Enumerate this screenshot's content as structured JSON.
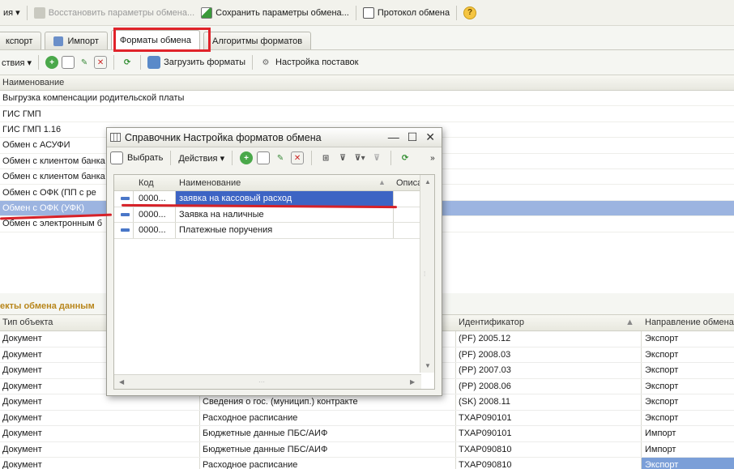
{
  "topbar": {
    "menu_label": "ия ▾",
    "restore_label": "Восстановить параметры обмена...",
    "save_label": "Сохранить параметры обмена...",
    "protocol_label": "Протокол обмена",
    "help_glyph": "?"
  },
  "tabs": [
    {
      "label": "кспорт"
    },
    {
      "label": "Импорт"
    },
    {
      "label": "Форматы обмена"
    },
    {
      "label": "Алгоритмы форматов"
    }
  ],
  "toolbar": {
    "actions_label": "ствия ▾",
    "load_formats_label": "Загрузить форматы",
    "supply_settings_label": "Настройка поставок"
  },
  "format_list": {
    "header": "Наименование",
    "rows": [
      "Выгрузка компенсации родительской платы",
      "ГИС ГМП",
      "ГИС ГМП 1.16",
      "Обмен с АСУФИ",
      "Обмен с клиентом банка",
      "Обмен с клиентом банка",
      "Обмен с ОФК (ПП с ре",
      "Обмен с ОФК (УФК)",
      "Обмен с электронным б"
    ],
    "selected_index": 7
  },
  "objects_section": {
    "title": "екты обмена данным",
    "headers": {
      "type": "Тип объекта",
      "id": "Идентификатор",
      "direction": "Направление обмена"
    },
    "rows": [
      {
        "type": "Документ",
        "name": "",
        "id": "(PF) 2005.12",
        "direction": "Экспорт"
      },
      {
        "type": "Документ",
        "name": "",
        "id": "(PF) 2008.03",
        "direction": "Экспорт"
      },
      {
        "type": "Документ",
        "name": "",
        "id": "(PP) 2007.03",
        "direction": "Экспорт"
      },
      {
        "type": "Документ",
        "name": "",
        "id": "(PP) 2008.06",
        "direction": "Экспорт"
      },
      {
        "type": "Документ",
        "name": "Сведения о гос. (муницип.) контракте",
        "id": "(SK) 2008.11",
        "direction": "Экспорт"
      },
      {
        "type": "Документ",
        "name": "Расходное расписание",
        "id": "TXAP090101",
        "direction": "Экспорт"
      },
      {
        "type": "Документ",
        "name": "Бюджетные данные ПБС/АИФ",
        "id": "TXAP090101",
        "direction": "Импорт"
      },
      {
        "type": "Документ",
        "name": "Бюджетные данные ПБС/АИФ",
        "id": "TXAP090810",
        "direction": "Импорт"
      },
      {
        "type": "Документ",
        "name": "Расходное расписание",
        "id": "TXAP090810",
        "direction": "Экспорт"
      }
    ]
  },
  "dialog": {
    "title": "Справочник Настройка форматов обмена",
    "toolbar": {
      "select_label": "Выбрать",
      "actions_label": "Действия ▾"
    },
    "headers": {
      "code": "Код",
      "name": "Наименование",
      "desc": "Описа"
    },
    "rows": [
      {
        "code": "0000...",
        "name": "заявка на кассовый расход"
      },
      {
        "code": "0000...",
        "name": "Заявка на наличные"
      },
      {
        "code": "0000...",
        "name": "Платежные поручения"
      }
    ],
    "selected_index": 0
  },
  "colors": {
    "annotation_red": "#d62128",
    "selection_blue": "#3d64c4",
    "list_selection": "#9cb4e0",
    "section_title": "#b8861c"
  }
}
